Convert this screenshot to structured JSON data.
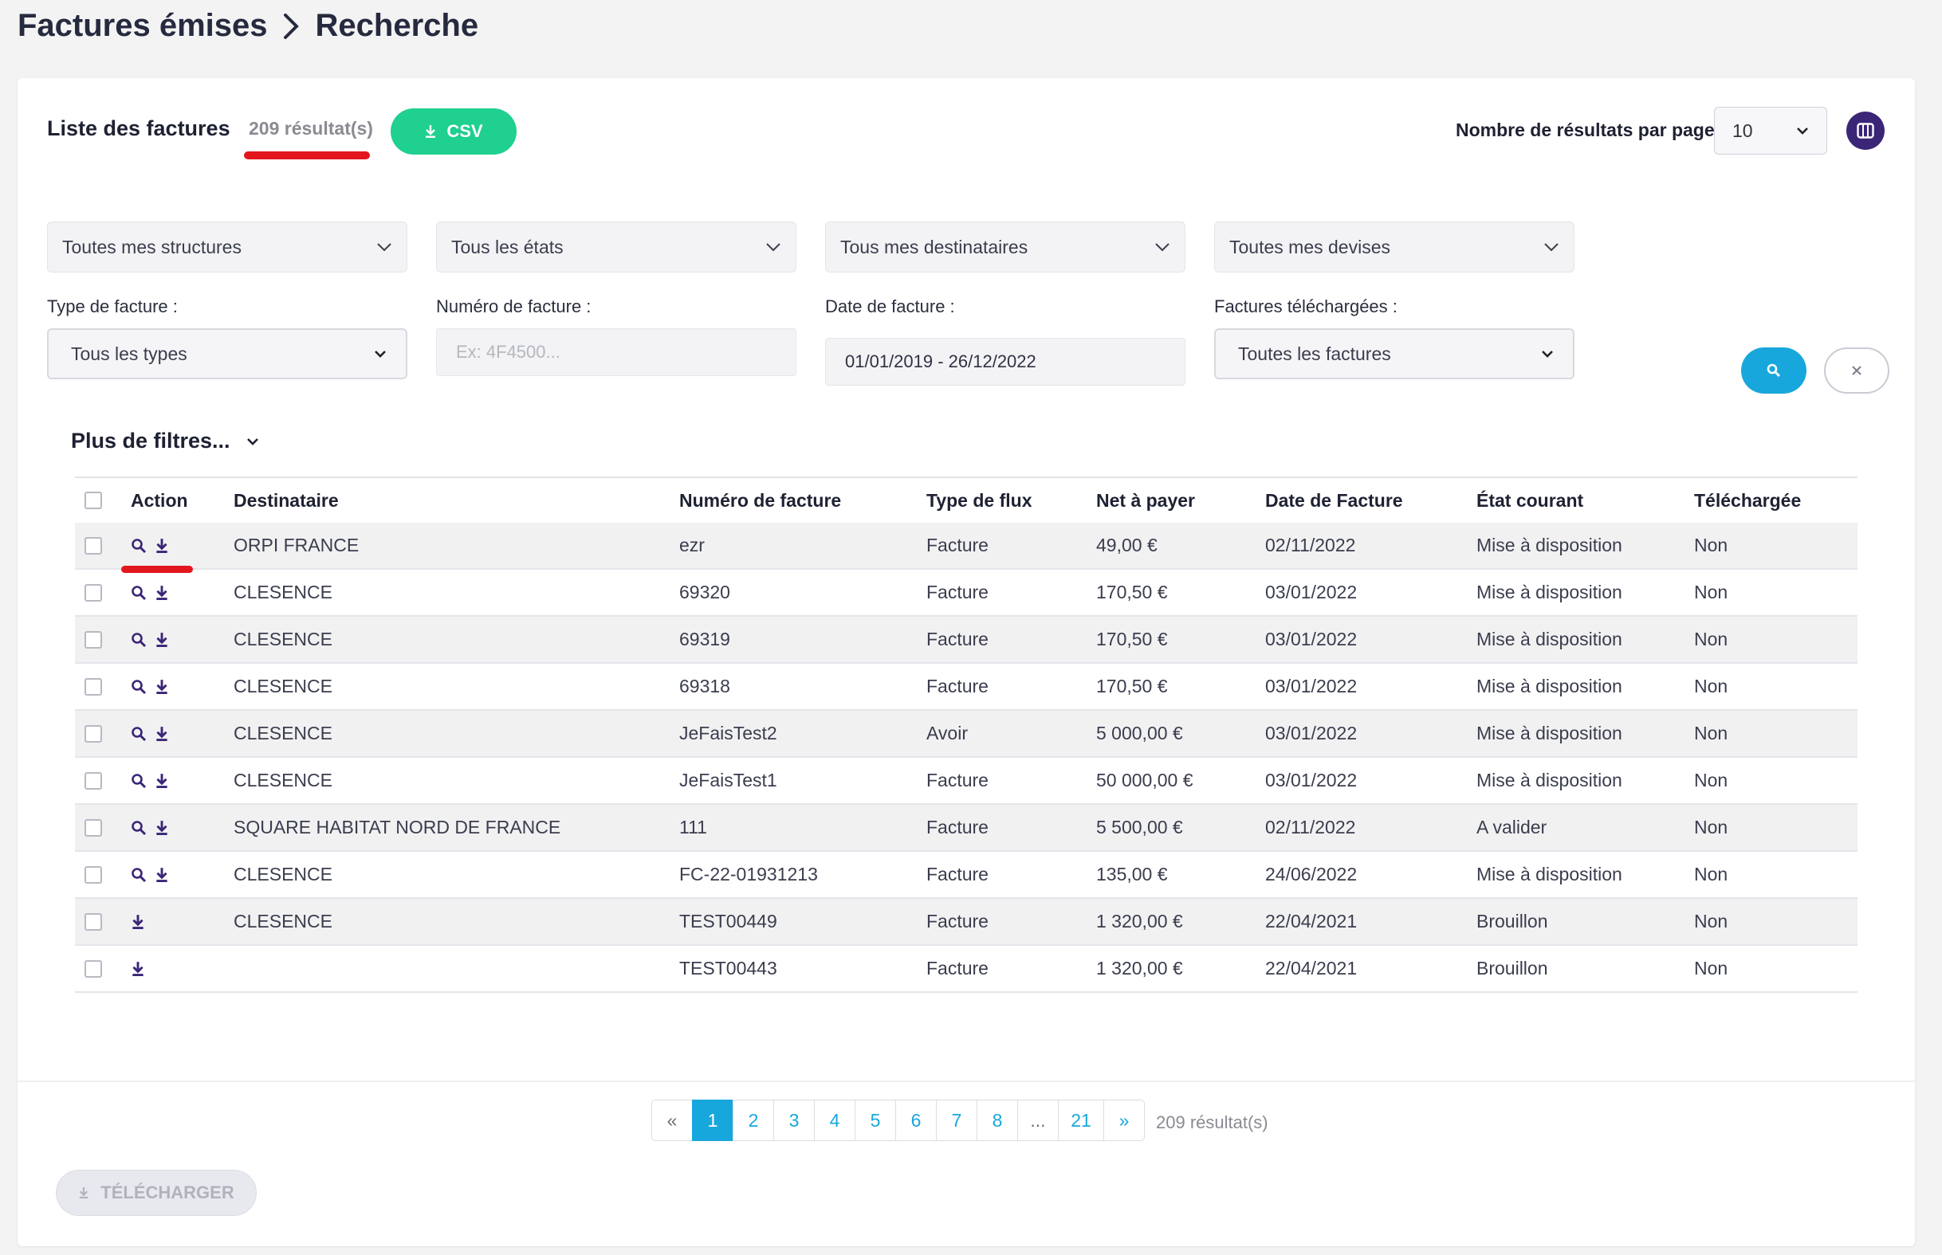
{
  "breadcrumb": {
    "parent": "Factures émises",
    "current": "Recherche"
  },
  "toolbar": {
    "list_title": "Liste des factures",
    "result_count": "209 résultat(s)",
    "csv_label": "CSV",
    "per_page_label": "Nombre de résultats par page :",
    "per_page_value": "10"
  },
  "filters": {
    "structures": "Toutes mes structures",
    "etats": "Tous les états",
    "destinataires": "Tous mes destinataires",
    "devises": "Toutes mes devises",
    "type_label": "Type de facture :",
    "type_value": "Tous les types",
    "numero_label": "Numéro de facture :",
    "numero_placeholder": "Ex: 4F4500...",
    "date_label": "Date de facture :",
    "date_value": "01/01/2019 - 26/12/2022",
    "telecharge_label": "Factures téléchargées :",
    "telecharge_value": "Toutes les factures",
    "more_filters": "Plus de filtres..."
  },
  "table": {
    "headers": {
      "action": "Action",
      "destinataire": "Destinataire",
      "numero": "Numéro de facture",
      "type_flux": "Type de flux",
      "net": "Net à payer",
      "date": "Date de Facture",
      "etat": "État courant",
      "telecharge": "Téléchargée"
    },
    "rows": [
      {
        "destinataire": "ORPI FRANCE",
        "numero": "ezr",
        "type_flux": "Facture",
        "net": "49,00 €",
        "date": "02/11/2022",
        "etat": "Mise à disposition",
        "telecharge": "Non"
      },
      {
        "destinataire": "CLESENCE",
        "numero": "69320",
        "type_flux": "Facture",
        "net": "170,50 €",
        "date": "03/01/2022",
        "etat": "Mise à disposition",
        "telecharge": "Non"
      },
      {
        "destinataire": "CLESENCE",
        "numero": "69319",
        "type_flux": "Facture",
        "net": "170,50 €",
        "date": "03/01/2022",
        "etat": "Mise à disposition",
        "telecharge": "Non"
      },
      {
        "destinataire": "CLESENCE",
        "numero": "69318",
        "type_flux": "Facture",
        "net": "170,50 €",
        "date": "03/01/2022",
        "etat": "Mise à disposition",
        "telecharge": "Non"
      },
      {
        "destinataire": "CLESENCE",
        "numero": "JeFaisTest2",
        "type_flux": "Avoir",
        "net": "5 000,00 €",
        "date": "03/01/2022",
        "etat": "Mise à disposition",
        "telecharge": "Non"
      },
      {
        "destinataire": "CLESENCE",
        "numero": "JeFaisTest1",
        "type_flux": "Facture",
        "net": "50 000,00 €",
        "date": "03/01/2022",
        "etat": "Mise à disposition",
        "telecharge": "Non"
      },
      {
        "destinataire": "SQUARE HABITAT NORD DE FRANCE",
        "numero": "111",
        "type_flux": "Facture",
        "net": "5 500,00 €",
        "date": "02/11/2022",
        "etat": "A valider",
        "telecharge": "Non"
      },
      {
        "destinataire": "CLESENCE",
        "numero": "FC-22-01931213",
        "type_flux": "Facture",
        "net": "135,00 €",
        "date": "24/06/2022",
        "etat": "Mise à disposition",
        "telecharge": "Non"
      },
      {
        "destinataire": "CLESENCE",
        "numero": "TEST00449",
        "type_flux": "Facture",
        "net": "1 320,00 €",
        "date": "22/04/2021",
        "etat": "Brouillon",
        "telecharge": "Non"
      },
      {
        "destinataire": "",
        "numero": "TEST00443",
        "type_flux": "Facture",
        "net": "1 320,00 €",
        "date": "22/04/2021",
        "etat": "Brouillon",
        "telecharge": "Non"
      }
    ]
  },
  "pagination": {
    "prev": "«",
    "pages": [
      "1",
      "2",
      "3",
      "4",
      "5",
      "6",
      "7",
      "8",
      "...",
      "21"
    ],
    "next": "»",
    "count": "209 résultat(s)"
  },
  "footer": {
    "download_label": "TÉLÉCHARGER"
  },
  "colors": {
    "accent": "#18a7dc",
    "success": "#1fd08f",
    "brand": "#3b2577",
    "highlight": "#e3161e"
  },
  "icons": [
    "chevron-right-icon",
    "download-icon",
    "columns-icon",
    "chevron-down-icon",
    "search-icon",
    "close-icon"
  ]
}
